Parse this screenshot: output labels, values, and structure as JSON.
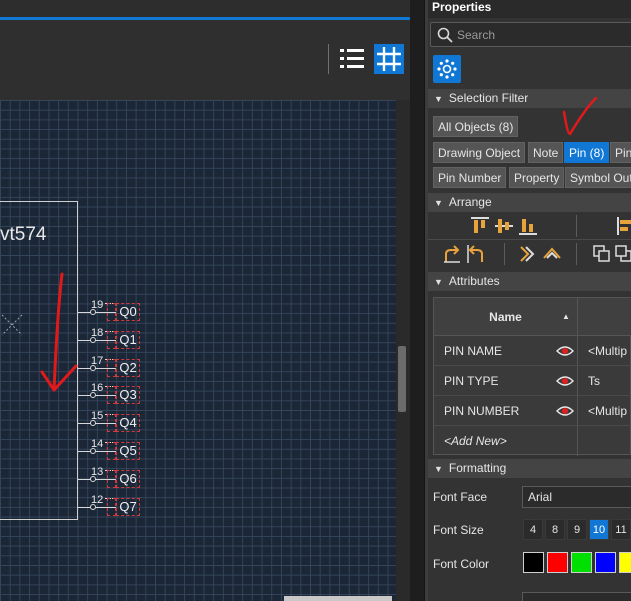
{
  "toolbar": {
    "list_view_icon": "list-icon",
    "grid_view_icon": "grid-icon"
  },
  "canvas": {
    "part_name": "vt574",
    "pins": [
      {
        "number": "19",
        "name": "Q0"
      },
      {
        "number": "18",
        "name": "Q1"
      },
      {
        "number": "17",
        "name": "Q2"
      },
      {
        "number": "16",
        "name": "Q3"
      },
      {
        "number": "15",
        "name": "Q4"
      },
      {
        "number": "14",
        "name": "Q5"
      },
      {
        "number": "13",
        "name": "Q6"
      },
      {
        "number": "12",
        "name": "Q7"
      }
    ]
  },
  "panel": {
    "title": "Properties",
    "search_placeholder": "Search",
    "selection_filter": {
      "header": "Selection Filter",
      "chips": [
        "All Objects (8)",
        "Drawing Object",
        "Note",
        "Pin (8)",
        "Pin",
        "Pin Number",
        "Property",
        "Symbol Out"
      ],
      "active_chip": "Pin (8)"
    },
    "arrange": {
      "header": "Arrange"
    },
    "attributes": {
      "header": "Attributes",
      "col_name": "Name",
      "rows": [
        {
          "name": "PIN NAME",
          "value": "<Multip"
        },
        {
          "name": "PIN TYPE",
          "value": "Ts"
        },
        {
          "name": "PIN NUMBER",
          "value": "<Multip"
        }
      ],
      "add_new": "<Add New>"
    },
    "formatting": {
      "header": "Formatting",
      "font_face_label": "Font Face",
      "font_face_value": "Arial",
      "font_size_label": "Font Size",
      "font_sizes": [
        "4",
        "8",
        "9",
        "10",
        "11"
      ],
      "selected_font_size": "10",
      "font_color_label": "Font Color",
      "colors": [
        "#000000",
        "#ff0000",
        "#00e000",
        "#0000ff",
        "#ffff00"
      ]
    }
  }
}
